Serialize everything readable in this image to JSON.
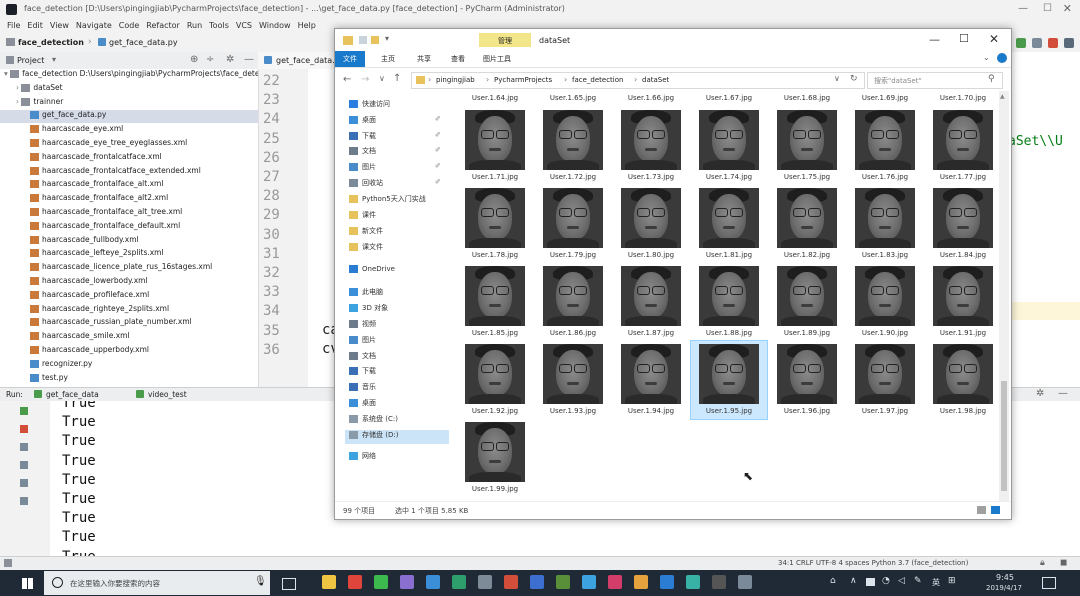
{
  "ide": {
    "title": "face_detection [D:\\Users\\pingingjiab\\PycharmProjects\\face_detection] - ...\\get_face_data.py [face_detection] - PyCharm (Administrator)",
    "menu": [
      "File",
      "Edit",
      "View",
      "Navigate",
      "Code",
      "Refactor",
      "Run",
      "Tools",
      "VCS",
      "Window",
      "Help"
    ],
    "breadcrumb_project": "face_detection",
    "breadcrumb_file": "get_face_data.py",
    "project_panel_label": "Project",
    "editor_tab": "get_face_data.py",
    "tree": [
      {
        "label": "face_detection  D:\\Users\\pingingjiab\\PycharmProjects\\face_detection",
        "kind": "root"
      },
      {
        "label": "dataSet",
        "kind": "folder"
      },
      {
        "label": "trainner",
        "kind": "folder"
      },
      {
        "label": "get_face_data.py",
        "kind": "py",
        "selected": true
      },
      {
        "label": "haarcascade_eye.xml",
        "kind": "xml"
      },
      {
        "label": "haarcascade_eye_tree_eyeglasses.xml",
        "kind": "xml"
      },
      {
        "label": "haarcascade_frontalcatface.xml",
        "kind": "xml"
      },
      {
        "label": "haarcascade_frontalcatface_extended.xml",
        "kind": "xml"
      },
      {
        "label": "haarcascade_frontalface_alt.xml",
        "kind": "xml"
      },
      {
        "label": "haarcascade_frontalface_alt2.xml",
        "kind": "xml"
      },
      {
        "label": "haarcascade_frontalface_alt_tree.xml",
        "kind": "xml"
      },
      {
        "label": "haarcascade_frontalface_default.xml",
        "kind": "xml"
      },
      {
        "label": "haarcascade_fullbody.xml",
        "kind": "xml"
      },
      {
        "label": "haarcascade_lefteye_2splits.xml",
        "kind": "xml"
      },
      {
        "label": "haarcascade_licence_plate_rus_16stages.xml",
        "kind": "xml"
      },
      {
        "label": "haarcascade_lowerbody.xml",
        "kind": "xml"
      },
      {
        "label": "haarcascade_profileface.xml",
        "kind": "xml"
      },
      {
        "label": "haarcascade_righteye_2splits.xml",
        "kind": "xml"
      },
      {
        "label": "haarcascade_russian_plate_number.xml",
        "kind": "xml"
      },
      {
        "label": "haarcascade_smile.xml",
        "kind": "xml"
      },
      {
        "label": "haarcascade_upperbody.xml",
        "kind": "xml"
      },
      {
        "label": "recognizer.py",
        "kind": "py"
      },
      {
        "label": "test.py",
        "kind": "py"
      }
    ],
    "line_numbers": [
      "22",
      "23",
      "24",
      "25",
      "26",
      "27",
      "28",
      "29",
      "30",
      "31",
      "32",
      "33",
      "34",
      "35",
      "36"
    ],
    "code_35": "ca",
    "code_36": "cv",
    "right_code": "aSet\\\\U",
    "run_label": "Run:",
    "run_tabs": [
      "get_face_data",
      "video_test"
    ],
    "run_output": [
      "True",
      "True",
      "True",
      "True",
      "True",
      "True",
      "True",
      "True",
      "True"
    ],
    "status_right": "34:1  CRLF  UTF-8  4 spaces  Python 3.7 (face_detection)"
  },
  "explorer": {
    "ribbon_context_tab": "管理",
    "title": "dataSet",
    "tabs": [
      "文件",
      "主页",
      "共享",
      "查看",
      "图片工具"
    ],
    "path": [
      "pingingjiab",
      "PycharmProjects",
      "face_detection",
      "dataSet"
    ],
    "search_placeholder": "搜索\"dataSet\"",
    "nav": [
      {
        "label": "快速访问",
        "icon": "star-icon",
        "color": "#2a7de1"
      },
      {
        "label": "桌面",
        "icon": "desktop-icon",
        "color": "#3b8fd9",
        "pinned": true
      },
      {
        "label": "下载",
        "icon": "download-icon",
        "color": "#3b6fb5",
        "pinned": true
      },
      {
        "label": "文档",
        "icon": "document-icon",
        "color": "#6d7b8a",
        "pinned": true
      },
      {
        "label": "图片",
        "icon": "picture-icon",
        "color": "#4a8bc9",
        "pinned": true
      },
      {
        "label": "回收站",
        "icon": "recycle-bin-icon",
        "color": "#7a8a99",
        "pinned": true
      },
      {
        "label": "Python5天入门实战",
        "icon": "folder-icon",
        "color": "#e8c25a"
      },
      {
        "label": "课件",
        "icon": "folder-icon",
        "color": "#e8c25a"
      },
      {
        "label": "新文件",
        "icon": "folder-icon",
        "color": "#e8c25a"
      },
      {
        "label": "课文件",
        "icon": "folder-icon",
        "color": "#e8c25a"
      },
      {
        "label": "OneDrive",
        "icon": "cloud-icon",
        "color": "#2b7cd3"
      },
      {
        "label": "此电脑",
        "icon": "computer-icon",
        "color": "#3b8fd9"
      },
      {
        "label": "3D 对象",
        "icon": "cube-icon",
        "color": "#3ca3e0"
      },
      {
        "label": "视频",
        "icon": "video-icon",
        "color": "#6d7b8a"
      },
      {
        "label": "图片",
        "icon": "picture-icon",
        "color": "#4a8bc9"
      },
      {
        "label": "文档",
        "icon": "document-icon",
        "color": "#6d7b8a"
      },
      {
        "label": "下载",
        "icon": "download-icon",
        "color": "#3b6fb5"
      },
      {
        "label": "音乐",
        "icon": "music-icon",
        "color": "#3b6fb5"
      },
      {
        "label": "桌面",
        "icon": "desktop-icon",
        "color": "#3b8fd9"
      },
      {
        "label": "系统盘 (C:)",
        "icon": "drive-icon",
        "color": "#8a9aa9"
      },
      {
        "label": "存储盘 (D:)",
        "icon": "drive-icon",
        "color": "#8a9aa9",
        "selected": true
      },
      {
        "label": "网络",
        "icon": "network-icon",
        "color": "#3ca3e0"
      }
    ],
    "top_captions": [
      "User.1.64.jpg",
      "User.1.65.jpg",
      "User.1.66.jpg",
      "User.1.67.jpg",
      "User.1.68.jpg",
      "User.1.69.jpg",
      "User.1.70.jpg"
    ],
    "files": [
      "User.1.71.jpg",
      "User.1.72.jpg",
      "User.1.73.jpg",
      "User.1.74.jpg",
      "User.1.75.jpg",
      "User.1.76.jpg",
      "User.1.77.jpg",
      "User.1.78.jpg",
      "User.1.79.jpg",
      "User.1.80.jpg",
      "User.1.81.jpg",
      "User.1.82.jpg",
      "User.1.83.jpg",
      "User.1.84.jpg",
      "User.1.85.jpg",
      "User.1.86.jpg",
      "User.1.87.jpg",
      "User.1.88.jpg",
      "User.1.89.jpg",
      "User.1.90.jpg",
      "User.1.91.jpg",
      "User.1.92.jpg",
      "User.1.93.jpg",
      "User.1.94.jpg",
      "User.1.95.jpg",
      "User.1.96.jpg",
      "User.1.97.jpg",
      "User.1.98.jpg",
      "User.1.99.jpg"
    ],
    "selected_file": "User.1.95.jpg",
    "status_count": "99 个项目",
    "status_selection": "选中 1 个项目  5.85 KB"
  },
  "taskbar": {
    "search_placeholder": "在这里输入你要搜索的内容",
    "time": "9:45",
    "date": "2019/4/17",
    "ime": "英",
    "apps": [
      {
        "name": "file-explorer-icon",
        "color": "#f0c443"
      },
      {
        "name": "chrome-icon",
        "color": "#e0453b"
      },
      {
        "name": "wechat-icon",
        "color": "#3dba4e"
      },
      {
        "name": "app-icon",
        "color": "#8a6fd1"
      },
      {
        "name": "app-icon",
        "color": "#3a8fd8"
      },
      {
        "name": "app-icon",
        "color": "#2e9e6c"
      },
      {
        "name": "app-icon",
        "color": "#7d8b99"
      },
      {
        "name": "app-icon",
        "color": "#d24e3a"
      },
      {
        "name": "app-icon",
        "color": "#3d6fd1"
      },
      {
        "name": "app-icon",
        "color": "#5a8f3a"
      },
      {
        "name": "app-icon",
        "color": "#3ca3e0"
      },
      {
        "name": "app-icon",
        "color": "#d33d6a"
      },
      {
        "name": "app-icon",
        "color": "#e6a23c"
      },
      {
        "name": "app-icon",
        "color": "#2b7cd3"
      },
      {
        "name": "app-icon",
        "color": "#39b2a6"
      },
      {
        "name": "app-icon",
        "color": "#555555"
      },
      {
        "name": "app-icon",
        "color": "#7a8a99"
      }
    ]
  }
}
